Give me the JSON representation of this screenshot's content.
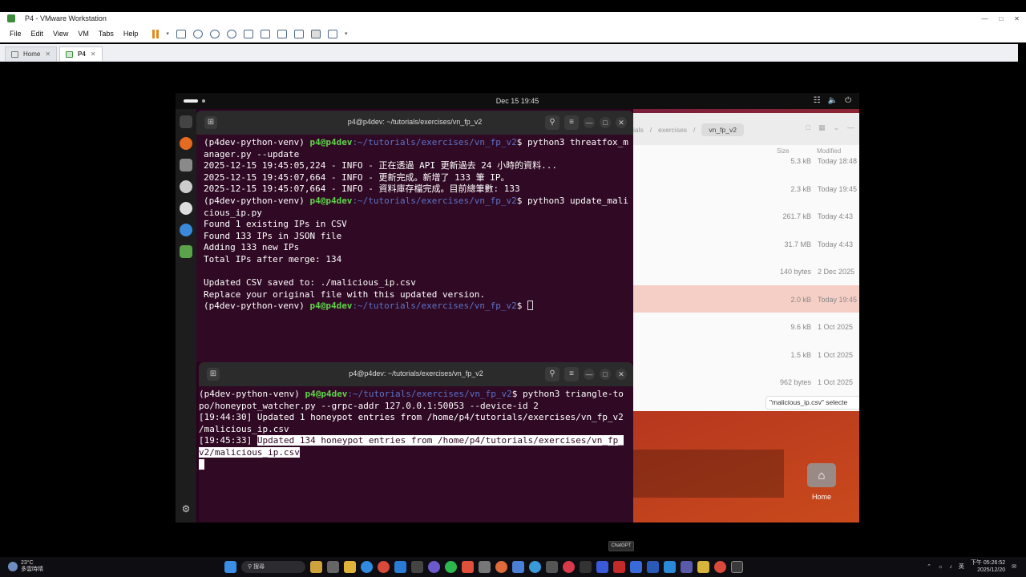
{
  "vmware": {
    "title": "P4 - VMware Workstation",
    "menu": [
      "File",
      "Edit",
      "View",
      "VM",
      "Tabs",
      "Help"
    ],
    "tabs": [
      {
        "label": "Home",
        "active": false
      },
      {
        "label": "P4",
        "active": true
      }
    ]
  },
  "guest": {
    "topbar": {
      "clock": "Dec 15  19:45"
    },
    "terminal1": {
      "title": "p4@p4dev: ~/tutorials/exercises/vn_fp_v2",
      "prompt_env": "(p4dev-python-venv) ",
      "prompt_user": "p4@p4dev",
      "prompt_path": ":~/tutorials/exercises/vn_fp_v2",
      "cmd1": "$ python3 threatfox_m",
      "cmd1b": "anager.py --update",
      "log1": "2025-12-15 19:45:05,224 - INFO - 正在透過 API 更新過去 24 小時的資料...",
      "log2": "2025-12-15 19:45:07,664 - INFO - 更新完成。新增了 133 筆 IP。",
      "log3": "2025-12-15 19:45:07,664 - INFO - 資料庫存檔完成。目前總筆數: 133",
      "cmd2": "$ python3 update_mali",
      "cmd2b": "cious_ip.py",
      "out1": "Found 1 existing IPs in CSV",
      "out2": "Found 133 IPs in JSON file",
      "out3": "Adding 133 new IPs",
      "out4": "Total IPs after merge: 134",
      "out5": "Updated CSV saved to: ./malicious_ip.csv",
      "out6": "Replace your original file with this updated version.",
      "prompt_end": "$ "
    },
    "terminal2": {
      "title": "p4@p4dev: ~/tutorials/exercises/vn_fp_v2",
      "cmd": "$ python3 triangle-to",
      "cmdb": "po/honeypot_watcher.py --grpc-addr 127.0.0.1:50053 --device-id 2",
      "log1": "[19:44:30] Updated 1 honeypot entries from /home/p4/tutorials/exercises/vn_fp_v2",
      "log1b": "/malicious_ip.csv",
      "log2ts": "[19:45:33] ",
      "log2": "Updated 134 honeypot entries from /home/p4/tutorials/exercises/vn_fp_",
      "log2b": "v2/malicious_ip.csv"
    },
    "files": {
      "breadcrumb_prev2": "ials",
      "breadcrumb_prev": "exercises",
      "breadcrumb_current": "vn_fp_v2",
      "col_size": "Size",
      "col_modified": "Modified",
      "rows": [
        {
          "size": "5.3 kB",
          "modified": "Today 18:48"
        },
        {
          "size": "2.3 kB",
          "modified": "Today 19:45"
        },
        {
          "size": "261.7 kB",
          "modified": "Today 4:43"
        },
        {
          "size": "31.7 MB",
          "modified": "Today 4:43"
        },
        {
          "size": "140 bytes",
          "modified": "2 Dec 2025"
        },
        {
          "size": "2.0 kB",
          "modified": "Today 19:45"
        },
        {
          "size": "9.6 kB",
          "modified": "1 Oct 2025"
        },
        {
          "size": "1.5 kB",
          "modified": "1 Oct 2025"
        },
        {
          "size": "962 bytes",
          "modified": "1 Oct 2025"
        }
      ],
      "selected_row": 5,
      "status": "\"malicious_ip.csv\" selecte"
    },
    "desktop": {
      "home_label": "Home"
    }
  },
  "taskbar": {
    "weather_temp": "23°C",
    "weather_desc": "多雲時晴",
    "search": "搜尋",
    "tooltip": "ChatGPT",
    "time": "下午 05:26:52",
    "date": "2025/12/20",
    "lang": "英"
  },
  "colors": {
    "terminal_bg": "#300a24",
    "prompt_user": "#5ed34a",
    "prompt_path": "#5b73c9",
    "selection": "#f5cfc6"
  }
}
